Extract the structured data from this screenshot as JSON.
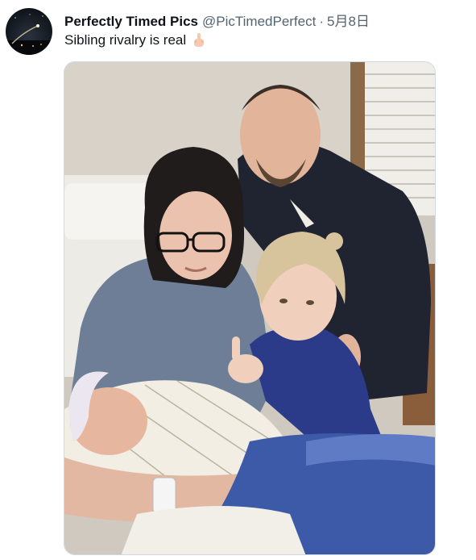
{
  "tweet": {
    "author": {
      "display_name": "Perfectly Timed Pics",
      "handle": "@PicTimedPerfect",
      "avatar_icon": "night-sky-avatar"
    },
    "separator": "·",
    "date": "5月8日",
    "text": "Sibling rivalry is real",
    "emoji_icon": "middle-finger-emoji",
    "media": {
      "alt": "Photo of a family: a father, a mother holding a swaddled newborn, and a toddler girl"
    }
  },
  "colors": {
    "primary_text": "#0f1419",
    "secondary_text": "#536471",
    "media_border": "#cfd9de"
  }
}
